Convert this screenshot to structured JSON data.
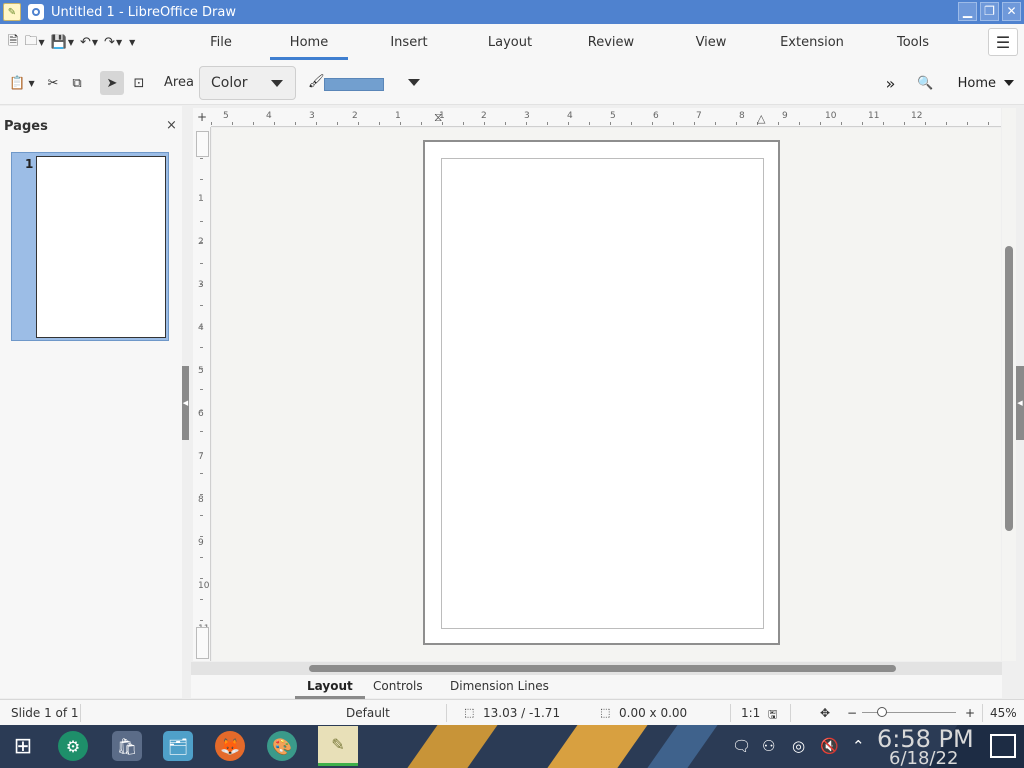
{
  "window": {
    "title": "Untitled 1 - LibreOffice Draw",
    "buttons": [
      "minimize",
      "restore",
      "close"
    ]
  },
  "menu_tabs": [
    "File",
    "Home",
    "Insert",
    "Layout",
    "Review",
    "View",
    "Extension",
    "Tools"
  ],
  "active_tab": "Home",
  "toolbar": {
    "area_label": "Area",
    "area_fill_type": "Color",
    "fill_color": "#729fcf",
    "context_menu_label": "Home"
  },
  "pages_pane": {
    "title": "Pages",
    "close_glyph": "×",
    "thumbnails": [
      {
        "number": "1"
      }
    ]
  },
  "ruler": {
    "horizontal_labels": [
      "5",
      "4",
      "3",
      "2",
      "1",
      "1",
      "2",
      "3",
      "4",
      "5",
      "6",
      "7",
      "8",
      "9",
      "10",
      "11",
      "12"
    ],
    "vertical_labels": [
      "1",
      "2",
      "3",
      "4",
      "5",
      "6",
      "7",
      "8",
      "9",
      "10",
      "11"
    ]
  },
  "layer_tabs": [
    "Layout",
    "Controls",
    "Dimension Lines"
  ],
  "active_layer": "Layout",
  "statusbar": {
    "slide": "Slide 1 of 1",
    "master": "Default",
    "position": "13.03 / -1.71",
    "size": "0.00 x 0.00",
    "scale": "1:1",
    "zoom_minus": "−",
    "zoom_plus": "+",
    "zoom": "45%"
  },
  "taskbar": {
    "time": "6:58 PM",
    "date": "6/18/22",
    "apps": [
      "start-menu",
      "discover",
      "store",
      "file-manager",
      "firefox",
      "color-picker",
      "libreoffice-draw"
    ]
  },
  "colors": {
    "titlebar": "#4f82cf",
    "active_tab_underline": "#3f7fd0",
    "page_selection": "#9cbde6"
  }
}
